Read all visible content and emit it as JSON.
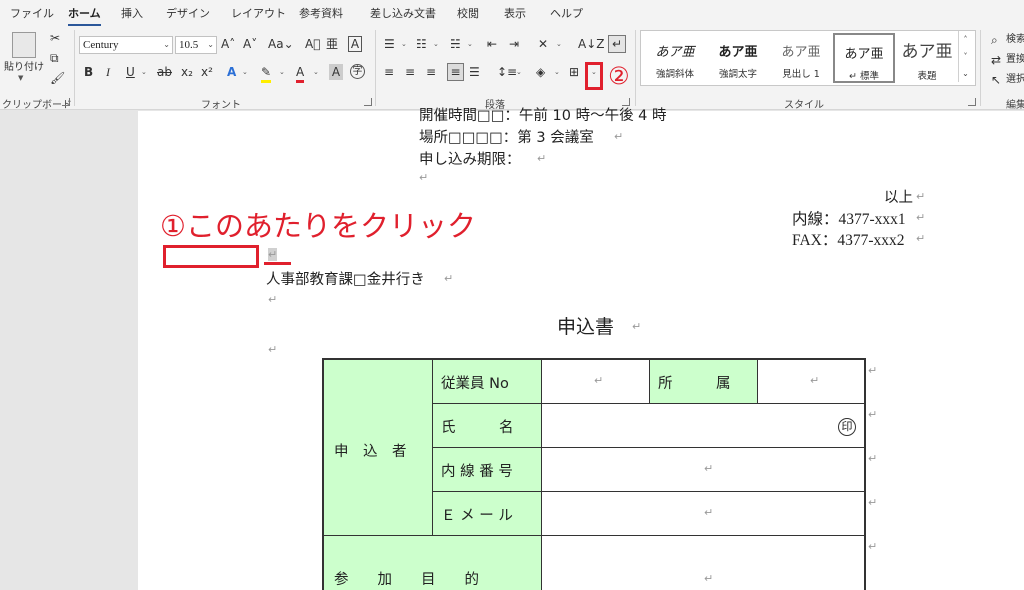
{
  "ribbon": {
    "tabs": [
      "ファイル",
      "ホーム",
      "挿入",
      "デザイン",
      "レイアウト",
      "参考資料",
      "差し込み文書",
      "校閲",
      "表示",
      "ヘルプ"
    ],
    "active_tab": "ホーム",
    "groups": {
      "clipboard": "クリップボード",
      "font": "フォント",
      "paragraph": "段落",
      "styles": "スタイル",
      "editing": "編集"
    },
    "paste_label": "貼り付け",
    "font_name": "Century",
    "font_size": "10.5",
    "styles": [
      {
        "preview": "あア亜",
        "name": "強調斜体"
      },
      {
        "preview": "あア亜",
        "name": "強調太字"
      },
      {
        "preview": "あア亜",
        "name": "見出し 1"
      },
      {
        "preview": "あア亜",
        "name": "↵ 標準"
      },
      {
        "preview": "あア亜",
        "name": "表題"
      }
    ],
    "editing": [
      "検索",
      "置換",
      "選択"
    ]
  },
  "doc": {
    "line_time": "開催時間□□：午前 10 時〜午後 4 時",
    "line_place": "場所□□□□：第 3 会議室",
    "line_deadline": "申し込み期限：",
    "ijo": "以上",
    "naisen": "内線：4377-xxx1",
    "fax": "FAX：4377-xxx2",
    "to": "人事部教育課□金井行き",
    "title": "申込書",
    "return_mark": "↵"
  },
  "annotations": {
    "step1": "①このあたりをクリック",
    "step2": "②"
  },
  "table": {
    "applicant": "申　込　者",
    "employee_no": "従業員 No",
    "dept": "所　　　属",
    "name": "氏　　　名",
    "seal": "印",
    "ext": "内 線 番 号",
    "email": "Ｅ メ ー ル",
    "purpose": "参　　加　　目　　的"
  }
}
